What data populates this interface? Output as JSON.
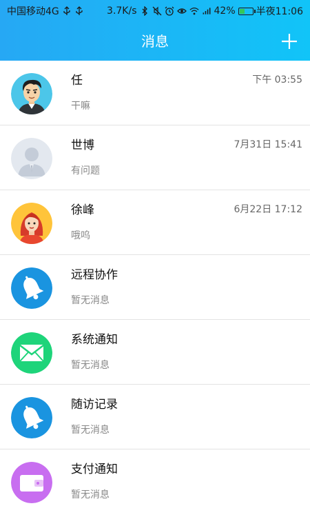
{
  "status_bar": {
    "carrier": "中国移动4G",
    "speed": "3.7K/s",
    "battery_percent": "42%",
    "battery_level": 0.42,
    "time": "半夜11:06"
  },
  "header": {
    "title": "消息"
  },
  "colors": {
    "header_gradient_start": "#26a8f4",
    "header_gradient_end": "#11c4f8",
    "bell_blue": "#1a94e0",
    "mail_green": "#1ed47a",
    "wallet_purple": "#c86ef0"
  },
  "messages": [
    {
      "name": "任",
      "time": "下午 03:55",
      "preview": "干嘛",
      "avatar": "male-cartoon-avatar"
    },
    {
      "name": "世博",
      "time": "7月31日 15:41",
      "preview": "有问题",
      "avatar": "default-user-avatar"
    },
    {
      "name": "徐峰",
      "time": "6月22日 17:12",
      "preview": "哦呜",
      "avatar": "female-cartoon-avatar"
    },
    {
      "name": "远程协作",
      "time": "",
      "preview": "暂无消息",
      "avatar": "bell-icon"
    },
    {
      "name": "系统通知",
      "time": "",
      "preview": "暂无消息",
      "avatar": "mail-icon"
    },
    {
      "name": "随访记录",
      "time": "",
      "preview": "暂无消息",
      "avatar": "bell-icon"
    },
    {
      "name": "支付通知",
      "time": "",
      "preview": "暂无消息",
      "avatar": "wallet-icon"
    }
  ]
}
